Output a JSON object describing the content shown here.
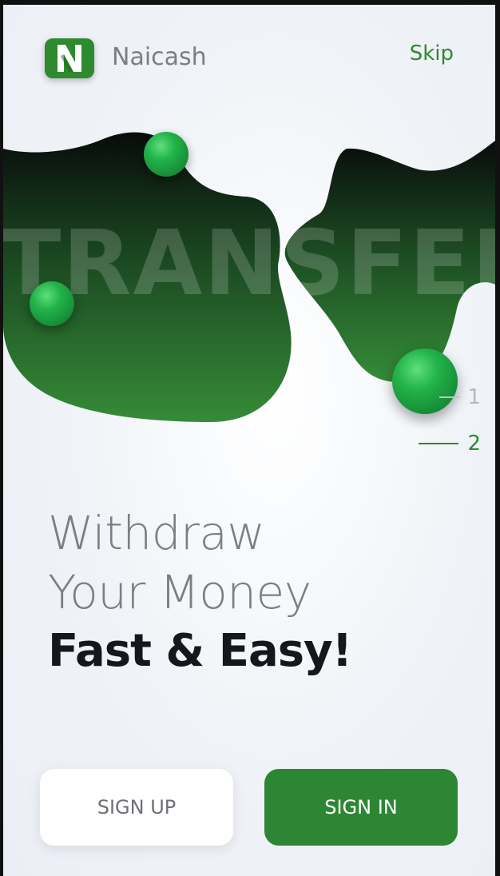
{
  "header": {
    "logo_letter": "N",
    "brand_name": "Naicash",
    "skip_label": "Skip"
  },
  "hero": {
    "watermark_text": "TRANSFER",
    "icon": "money-transfer-illustration"
  },
  "pager": {
    "items": [
      {
        "label": "1",
        "active": false
      },
      {
        "label": "2",
        "active": true
      }
    ]
  },
  "headline": {
    "line1": "Withdraw",
    "line2": "Your Money",
    "line3": "Fast & Easy!"
  },
  "actions": {
    "sign_up_label": "SIGN UP",
    "sign_in_label": "SIGN IN"
  },
  "colors": {
    "accent": "#2e8a2e",
    "blob_top": "#0a0f0d",
    "blob_bottom": "#338a35",
    "orb": "#22b34a",
    "muted_text": "#7b7e83",
    "dark_text": "#14171c"
  }
}
